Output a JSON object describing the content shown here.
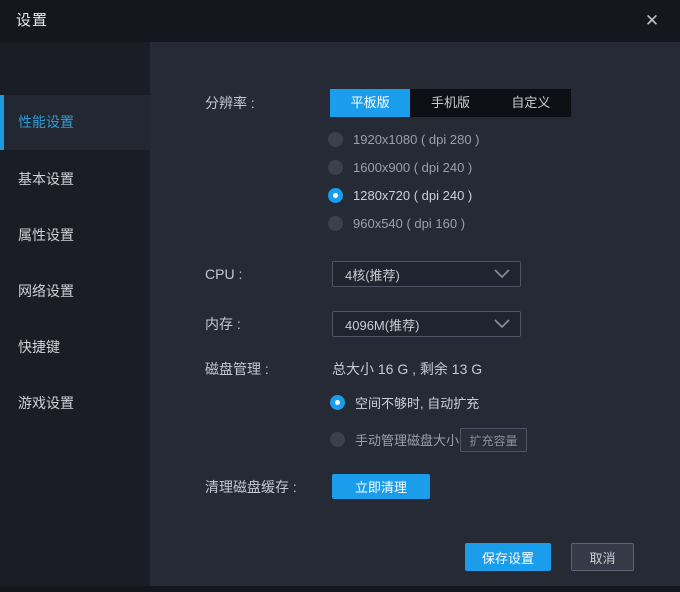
{
  "window": {
    "title": "设置",
    "close_icon": "✕"
  },
  "colors": {
    "accent_blue": "#1a9deb",
    "sidebar_active_text": "#2d9bd6",
    "titlebar_bg": "#15171f",
    "sidebar_bg": "#1a1d25",
    "content_bg": "#262a35",
    "tabbar_bg": "#0d0f15"
  },
  "sidebar": {
    "items": [
      {
        "label": "性能设置",
        "active": true
      },
      {
        "label": "基本设置",
        "active": false
      },
      {
        "label": "属性设置",
        "active": false
      },
      {
        "label": "网络设置",
        "active": false
      },
      {
        "label": "快捷键",
        "active": false
      },
      {
        "label": "游戏设置",
        "active": false
      }
    ]
  },
  "main": {
    "resolution": {
      "label": "分辨率 :",
      "tabs": [
        {
          "label": "平板版",
          "active": true
        },
        {
          "label": "手机版",
          "active": false
        },
        {
          "label": "自定义",
          "active": false
        }
      ],
      "options": [
        {
          "label": "1920x1080 ( dpi 280 )",
          "selected": false
        },
        {
          "label": "1600x900 ( dpi 240 )",
          "selected": false
        },
        {
          "label": "1280x720 ( dpi 240 )",
          "selected": true
        },
        {
          "label": "960x540 ( dpi 160 )",
          "selected": false
        }
      ]
    },
    "cpu": {
      "label": "CPU :",
      "value": "4核(推荐)"
    },
    "memory": {
      "label": "内存 :",
      "value": "4096M(推荐)"
    },
    "disk": {
      "label": "磁盘管理 :",
      "info": "总大小 16 G , 剩余 13 G",
      "options": [
        {
          "label": "空间不够时, 自动扩充",
          "selected": true
        },
        {
          "label": "手动管理磁盘大小",
          "selected": false
        }
      ],
      "expand_button": "扩充容量"
    },
    "cache": {
      "label": "清理磁盘缓存 :",
      "button": "立即清理"
    }
  },
  "footer": {
    "save_label": "保存设置",
    "cancel_label": "取消"
  }
}
